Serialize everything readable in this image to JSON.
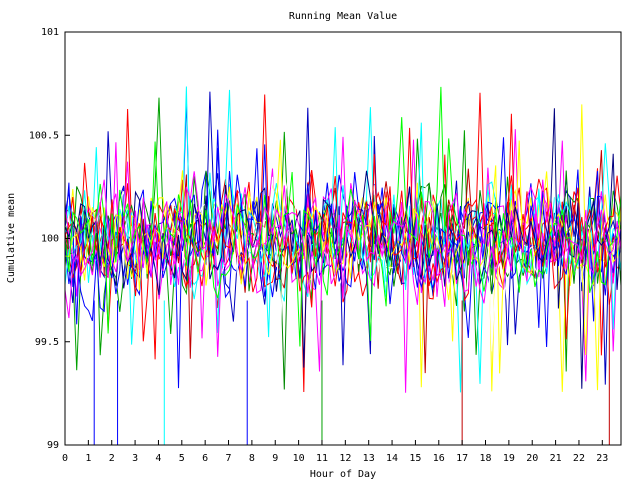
{
  "chart_data": {
    "type": "line",
    "title": "Running Mean Value",
    "xlabel": "Hour of Day",
    "ylabel": "Cumulative mean",
    "xlim": [
      0,
      23.8
    ],
    "ylim": [
      99,
      101
    ],
    "x_ticks": [
      0,
      1,
      2,
      3,
      4,
      5,
      6,
      7,
      8,
      9,
      10,
      11,
      12,
      13,
      14,
      15,
      16,
      17,
      18,
      19,
      20,
      21,
      22,
      23
    ],
    "y_ticks": [
      99,
      99.5,
      100,
      100.5,
      101
    ],
    "y_tick_labels": [
      "99",
      "99.5",
      "100",
      "100.5",
      "101"
    ],
    "center": 100,
    "band_halfwidth": 0.35,
    "samples_per_series": 143,
    "grid": false,
    "legend": "none",
    "series_colors": [
      "#ff0000",
      "#00a000",
      "#0000ff",
      "#ffff00",
      "#00ffff",
      "#ff00ff",
      "#c00000",
      "#0000c0",
      "#ff0000",
      "#0000ff",
      "#008800",
      "#ffffff",
      "#00ffff",
      "#ff00ff",
      "#0000ff",
      "#ff0000",
      "#ffff00",
      "#000080",
      "#00ff00",
      "#ff00ff"
    ],
    "spikes": [
      {
        "x": 1.25,
        "y": 99,
        "color": "#0000ff"
      },
      {
        "x": 2.25,
        "y": 99,
        "color": "#0000ff"
      },
      {
        "x": 4.25,
        "y": 99,
        "color": "#00ffff"
      },
      {
        "x": 7.8,
        "y": 99,
        "color": "#0000ff"
      },
      {
        "x": 11.0,
        "y": 99,
        "color": "#00a000"
      },
      {
        "x": 17.0,
        "y": 99,
        "color": "#c00000"
      },
      {
        "x": 23.3,
        "y": 99,
        "color": "#c00000"
      }
    ]
  }
}
